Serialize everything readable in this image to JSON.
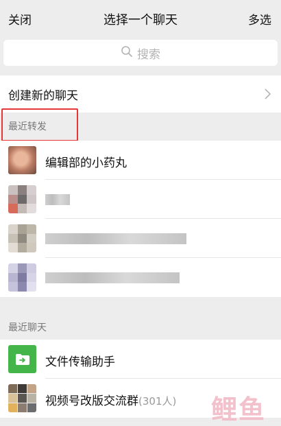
{
  "topbar": {
    "close_label": "关闭",
    "title": "选择一个聊天",
    "multi_select_label": "多选"
  },
  "search": {
    "placeholder": "搜索"
  },
  "create_new_chat_label": "创建新的聊天",
  "sections": {
    "recent_forward": "最近转发",
    "recent_chats": "最近聊天"
  },
  "recent_forward_items": [
    {
      "name": "编辑部的小药丸",
      "avatar_icon": "cat-photo-avatar"
    },
    {
      "name": "",
      "avatar_icon": "blurred-avatar"
    },
    {
      "name": "",
      "avatar_icon": "blurred-avatar"
    },
    {
      "name": "",
      "avatar_icon": "blurred-avatar"
    }
  ],
  "recent_chat_items": [
    {
      "name": "文件传输助手",
      "avatar_icon": "file-transfer-icon",
      "avatar_color": "#44b549"
    },
    {
      "name": "视频号改版交流群",
      "count": "(301人)",
      "avatar_icon": "group-grid-avatar"
    }
  ],
  "watermark_text": "鲤鱼",
  "colors": {
    "highlight": "#e53535",
    "file_transfer_green": "#44b549",
    "background": "#ededed"
  }
}
